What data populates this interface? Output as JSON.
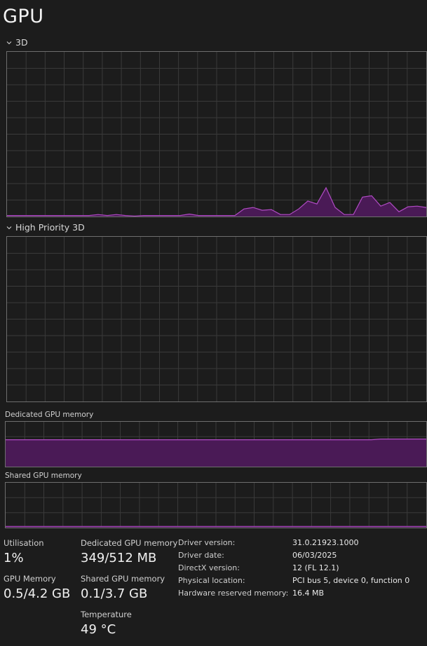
{
  "title": "GPU",
  "graphs": {
    "g3d": {
      "label": "3D",
      "values": [
        0.6,
        0.6,
        0.6,
        0.6,
        0.6,
        0.6,
        0.6,
        0.6,
        0.6,
        0.6,
        1.2,
        0.6,
        1.2,
        0.6,
        0.3,
        0.6,
        0.6,
        0.6,
        0.6,
        0.6,
        1.5,
        0.6,
        0.6,
        0.6,
        0.6,
        0.6,
        4.6,
        5.5,
        3.8,
        4.2,
        1.2,
        1.2,
        4.6,
        9.4,
        7.6,
        17.5,
        5.5,
        1.2,
        1.2,
        11.8,
        12.6,
        6.3,
        8.5,
        2.9,
        5.9,
        6.3,
        5.5
      ]
    },
    "ghp": {
      "label": "High Priority 3D",
      "values": []
    },
    "dedicated": {
      "label": "Dedicated GPU memory",
      "values": [
        60,
        60,
        60,
        60,
        60,
        60,
        60,
        60,
        60,
        60,
        60,
        60,
        60,
        60,
        60,
        60,
        60,
        60,
        60,
        60,
        60,
        60,
        60,
        60,
        60,
        60,
        60,
        60,
        60,
        60,
        60,
        60,
        60,
        60,
        60,
        60,
        60,
        60,
        60,
        60,
        60,
        61.5,
        61.5,
        61.5,
        61.5,
        61.5,
        61.5
      ]
    },
    "shared": {
      "label": "Shared GPU memory",
      "values": [
        2.7,
        2.7,
        2.7,
        2.7,
        2.7,
        2.7,
        2.7,
        2.7,
        2.7,
        2.7,
        2.7,
        2.7,
        2.7,
        2.7,
        2.7,
        2.7,
        2.7,
        2.7,
        2.7,
        2.7,
        2.7,
        2.7,
        2.7,
        2.7,
        2.7,
        2.7,
        2.7,
        2.7,
        2.7,
        2.7,
        2.7,
        2.7,
        2.7,
        2.7,
        2.7,
        2.7,
        2.7,
        2.7,
        2.7,
        2.7,
        2.7,
        2.7,
        2.7,
        2.7,
        2.7,
        2.7,
        2.7
      ]
    }
  },
  "stats": {
    "utilisation": {
      "label": "Utilisation",
      "value": "1%"
    },
    "dedicated": {
      "label": "Dedicated GPU memory",
      "value": "349/512 MB"
    },
    "gpu_memory": {
      "label": "GPU Memory",
      "value": "0.5/4.2 GB"
    },
    "shared": {
      "label": "Shared GPU memory",
      "value": "0.1/3.7 GB"
    },
    "temperature": {
      "label": "Temperature",
      "value": "49 °C"
    }
  },
  "info": [
    {
      "key": "Driver version:",
      "value": "31.0.21923.1000"
    },
    {
      "key": "Driver date:",
      "value": "06/03/2025"
    },
    {
      "key": "DirectX version:",
      "value": "12 (FL 12.1)"
    },
    {
      "key": "Physical location:",
      "value": "PCI bus 5, device 0, function 0"
    },
    {
      "key": "Hardware reserved memory:",
      "value": "16.4 MB"
    }
  ],
  "colors": {
    "line": "#b04bc4",
    "fill": "#4a1a56",
    "grid": "#3a3a3a",
    "border": "#6e6e6e",
    "background": "#1c1c1c"
  }
}
